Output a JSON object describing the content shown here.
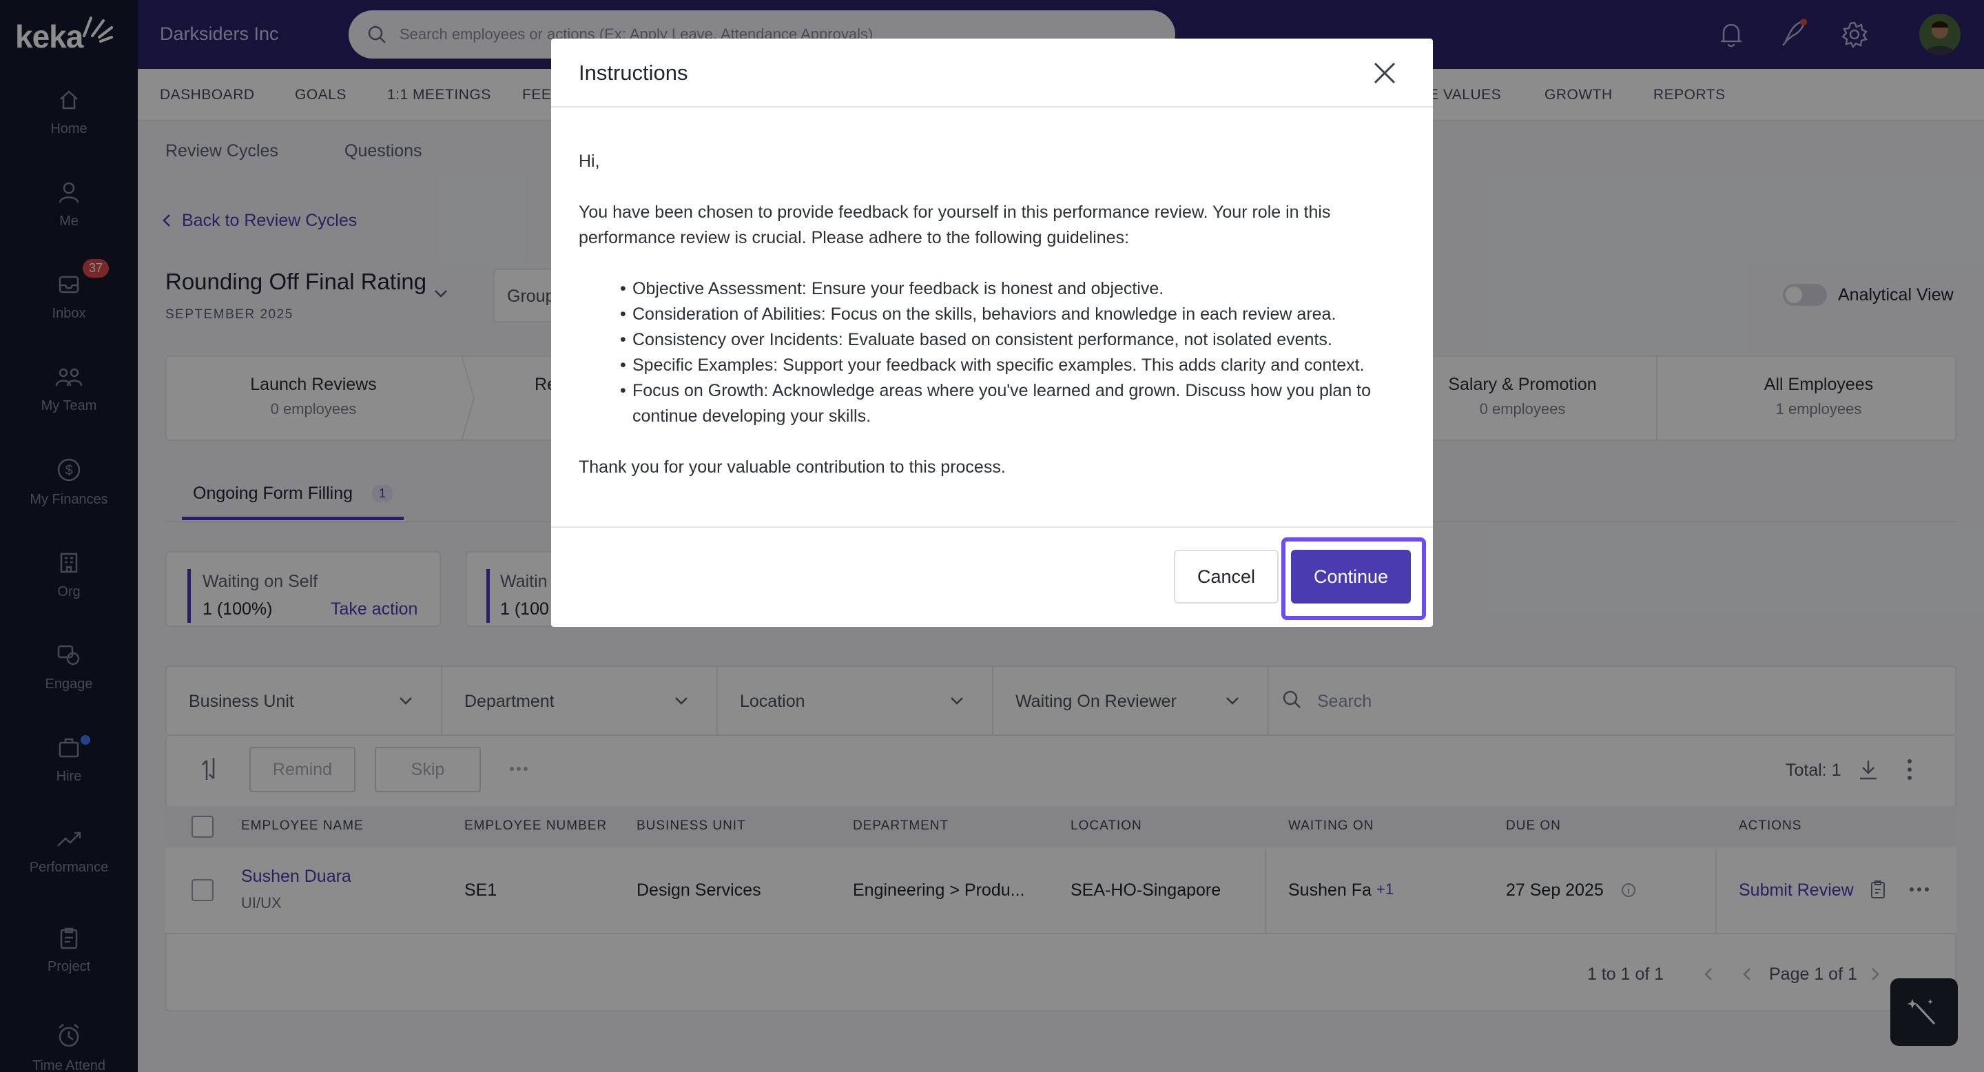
{
  "app": {
    "logo": "keka",
    "company": "Darksiders Inc"
  },
  "search": {
    "placeholder": "Search employees or actions (Ex: Apply Leave, Attendance Approvals)"
  },
  "sidebar": {
    "items": [
      {
        "label": "Home",
        "icon": "home-icon"
      },
      {
        "label": "Me",
        "icon": "user-icon"
      },
      {
        "label": "Inbox",
        "icon": "inbox-icon",
        "badge": "37"
      },
      {
        "label": "My Team",
        "icon": "team-icon"
      },
      {
        "label": "My Finances",
        "icon": "dollar-icon"
      },
      {
        "label": "Org",
        "icon": "org-icon"
      },
      {
        "label": "Engage",
        "icon": "engage-icon"
      },
      {
        "label": "Hire",
        "icon": "hire-icon"
      },
      {
        "label": "Performance",
        "icon": "performance-icon"
      },
      {
        "label": "Project",
        "icon": "project-icon"
      },
      {
        "label": "Time Attend",
        "icon": "clock-icon"
      }
    ]
  },
  "nav": {
    "items": [
      "DASHBOARD",
      "GOALS",
      "1:1 MEETINGS",
      "FEE",
      "E VALUES",
      "GROWTH",
      "REPORTS"
    ]
  },
  "subnav": {
    "tabs": [
      "Review Cycles",
      "Questions"
    ]
  },
  "page": {
    "back_link": "Back to Review Cycles",
    "title": "Rounding Off Final Rating",
    "subtitle": "SEPTEMBER 2025",
    "group_label": "Group",
    "analytical_view": "Analytical View"
  },
  "stages": [
    {
      "name": "Launch Reviews",
      "count": "0 employees"
    },
    {
      "name": "Re",
      "count": ""
    },
    {
      "name": "Salary & Promotion",
      "count": "0 employees"
    },
    {
      "name": "All Employees",
      "count": "1 employees"
    }
  ],
  "tabs": {
    "active_label": "Ongoing Form Filling",
    "active_count": "1"
  },
  "waiting": [
    {
      "title": "Waiting on Self",
      "value": "1 (100%)",
      "action": "Take action"
    },
    {
      "title": "Waitin",
      "value": "1 (100"
    }
  ],
  "filters": {
    "business_unit": "Business Unit",
    "department": "Department",
    "location": "Location",
    "waiting_on_reviewer": "Waiting On Reviewer",
    "search_placeholder": "Search"
  },
  "toolbar": {
    "remind": "Remind",
    "skip": "Skip",
    "total": "Total: 1"
  },
  "table": {
    "headers": [
      "EMPLOYEE NAME",
      "EMPLOYEE NUMBER",
      "BUSINESS UNIT",
      "DEPARTMENT",
      "LOCATION",
      "WAITING ON",
      "DUE ON",
      "ACTIONS"
    ],
    "rows": [
      {
        "name": "Sushen Duara",
        "role": "UI/UX",
        "number": "SE1",
        "business_unit": "Design Services",
        "department": "Engineering > Produ...",
        "location": "SEA-HO-Singapore",
        "waiting_on": "Sushen Fa",
        "waiting_extra": "+1",
        "due_on": "27 Sep 2025",
        "action": "Submit Review"
      }
    ]
  },
  "pagination": {
    "range": "1 to 1 of 1",
    "page": "Page 1 of 1"
  },
  "modal": {
    "title": "Instructions",
    "greeting": "Hi,",
    "intro": "You have been chosen to provide feedback for yourself in this performance review. Your role in this performance review is crucial. Please adhere to the following guidelines:",
    "bullets": [
      "Objective Assessment: Ensure your feedback is honest and objective.",
      "Consideration of Abilities: Focus on the  skills, behaviors and knowledge in each review area.",
      "Consistency over Incidents: Evaluate based on consistent performance, not isolated events.",
      "Specific Examples: Support your feedback with specific examples. This adds clarity and context.",
      "Focus on Growth: Acknowledge areas where you've learned and grown. Discuss how you plan to continue developing your skills."
    ],
    "closing": "Thank you for your valuable contribution to this process.",
    "cancel": "Cancel",
    "continue": "Continue"
  },
  "colors": {
    "brand": "#2a2269",
    "accent": "#4a3bb0",
    "focus_ring": "#6c4cf0",
    "sidebar": "#141b2d",
    "badge": "#d94a4a"
  }
}
